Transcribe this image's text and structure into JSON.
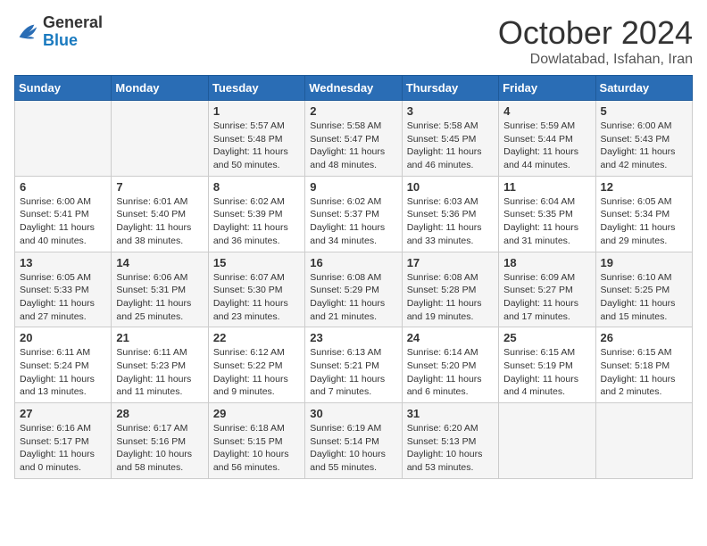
{
  "header": {
    "logo_general": "General",
    "logo_blue": "Blue",
    "month_title": "October 2024",
    "location": "Dowlatabad, Isfahan, Iran"
  },
  "calendar": {
    "days_of_week": [
      "Sunday",
      "Monday",
      "Tuesday",
      "Wednesday",
      "Thursday",
      "Friday",
      "Saturday"
    ],
    "weeks": [
      [
        {
          "day": "",
          "info": ""
        },
        {
          "day": "",
          "info": ""
        },
        {
          "day": "1",
          "info": "Sunrise: 5:57 AM\nSunset: 5:48 PM\nDaylight: 11 hours and 50 minutes."
        },
        {
          "day": "2",
          "info": "Sunrise: 5:58 AM\nSunset: 5:47 PM\nDaylight: 11 hours and 48 minutes."
        },
        {
          "day": "3",
          "info": "Sunrise: 5:58 AM\nSunset: 5:45 PM\nDaylight: 11 hours and 46 minutes."
        },
        {
          "day": "4",
          "info": "Sunrise: 5:59 AM\nSunset: 5:44 PM\nDaylight: 11 hours and 44 minutes."
        },
        {
          "day": "5",
          "info": "Sunrise: 6:00 AM\nSunset: 5:43 PM\nDaylight: 11 hours and 42 minutes."
        }
      ],
      [
        {
          "day": "6",
          "info": "Sunrise: 6:00 AM\nSunset: 5:41 PM\nDaylight: 11 hours and 40 minutes."
        },
        {
          "day": "7",
          "info": "Sunrise: 6:01 AM\nSunset: 5:40 PM\nDaylight: 11 hours and 38 minutes."
        },
        {
          "day": "8",
          "info": "Sunrise: 6:02 AM\nSunset: 5:39 PM\nDaylight: 11 hours and 36 minutes."
        },
        {
          "day": "9",
          "info": "Sunrise: 6:02 AM\nSunset: 5:37 PM\nDaylight: 11 hours and 34 minutes."
        },
        {
          "day": "10",
          "info": "Sunrise: 6:03 AM\nSunset: 5:36 PM\nDaylight: 11 hours and 33 minutes."
        },
        {
          "day": "11",
          "info": "Sunrise: 6:04 AM\nSunset: 5:35 PM\nDaylight: 11 hours and 31 minutes."
        },
        {
          "day": "12",
          "info": "Sunrise: 6:05 AM\nSunset: 5:34 PM\nDaylight: 11 hours and 29 minutes."
        }
      ],
      [
        {
          "day": "13",
          "info": "Sunrise: 6:05 AM\nSunset: 5:33 PM\nDaylight: 11 hours and 27 minutes."
        },
        {
          "day": "14",
          "info": "Sunrise: 6:06 AM\nSunset: 5:31 PM\nDaylight: 11 hours and 25 minutes."
        },
        {
          "day": "15",
          "info": "Sunrise: 6:07 AM\nSunset: 5:30 PM\nDaylight: 11 hours and 23 minutes."
        },
        {
          "day": "16",
          "info": "Sunrise: 6:08 AM\nSunset: 5:29 PM\nDaylight: 11 hours and 21 minutes."
        },
        {
          "day": "17",
          "info": "Sunrise: 6:08 AM\nSunset: 5:28 PM\nDaylight: 11 hours and 19 minutes."
        },
        {
          "day": "18",
          "info": "Sunrise: 6:09 AM\nSunset: 5:27 PM\nDaylight: 11 hours and 17 minutes."
        },
        {
          "day": "19",
          "info": "Sunrise: 6:10 AM\nSunset: 5:25 PM\nDaylight: 11 hours and 15 minutes."
        }
      ],
      [
        {
          "day": "20",
          "info": "Sunrise: 6:11 AM\nSunset: 5:24 PM\nDaylight: 11 hours and 13 minutes."
        },
        {
          "day": "21",
          "info": "Sunrise: 6:11 AM\nSunset: 5:23 PM\nDaylight: 11 hours and 11 minutes."
        },
        {
          "day": "22",
          "info": "Sunrise: 6:12 AM\nSunset: 5:22 PM\nDaylight: 11 hours and 9 minutes."
        },
        {
          "day": "23",
          "info": "Sunrise: 6:13 AM\nSunset: 5:21 PM\nDaylight: 11 hours and 7 minutes."
        },
        {
          "day": "24",
          "info": "Sunrise: 6:14 AM\nSunset: 5:20 PM\nDaylight: 11 hours and 6 minutes."
        },
        {
          "day": "25",
          "info": "Sunrise: 6:15 AM\nSunset: 5:19 PM\nDaylight: 11 hours and 4 minutes."
        },
        {
          "day": "26",
          "info": "Sunrise: 6:15 AM\nSunset: 5:18 PM\nDaylight: 11 hours and 2 minutes."
        }
      ],
      [
        {
          "day": "27",
          "info": "Sunrise: 6:16 AM\nSunset: 5:17 PM\nDaylight: 11 hours and 0 minutes."
        },
        {
          "day": "28",
          "info": "Sunrise: 6:17 AM\nSunset: 5:16 PM\nDaylight: 10 hours and 58 minutes."
        },
        {
          "day": "29",
          "info": "Sunrise: 6:18 AM\nSunset: 5:15 PM\nDaylight: 10 hours and 56 minutes."
        },
        {
          "day": "30",
          "info": "Sunrise: 6:19 AM\nSunset: 5:14 PM\nDaylight: 10 hours and 55 minutes."
        },
        {
          "day": "31",
          "info": "Sunrise: 6:20 AM\nSunset: 5:13 PM\nDaylight: 10 hours and 53 minutes."
        },
        {
          "day": "",
          "info": ""
        },
        {
          "day": "",
          "info": ""
        }
      ]
    ]
  }
}
